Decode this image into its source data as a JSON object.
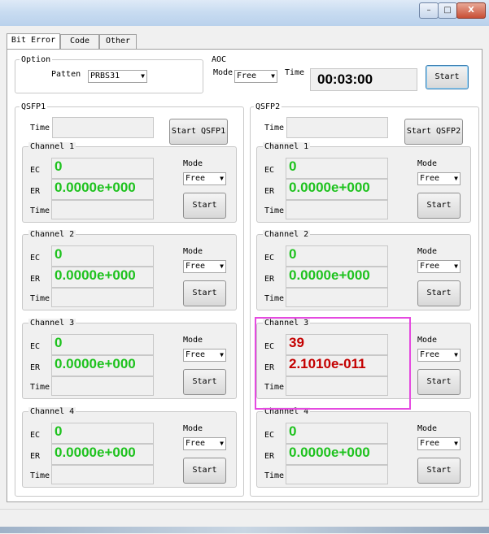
{
  "window": {
    "minimize_label": "–",
    "maximize_label": "□",
    "close_label": "X"
  },
  "tabs": [
    {
      "label": "Bit Error"
    },
    {
      "label": "Code"
    },
    {
      "label": "Other"
    }
  ],
  "option": {
    "group_label": "Option",
    "pattern_label": "Patten",
    "pattern_value": "PRBS31"
  },
  "aoc": {
    "group_label": "AOC",
    "mode_label": "Mode",
    "mode_value": "Free",
    "time_label": "Time",
    "timer": "00:03:00",
    "start_label": "Start"
  },
  "qsfp1": {
    "group_label": "QSFP1",
    "time_label": "Time",
    "start_label": "Start QSFP1",
    "channels": [
      {
        "label": "Channel 1",
        "ec": "0",
        "er": "0.0000e+000",
        "mode_label": "Mode",
        "mode": "Free",
        "start_label": "Start",
        "ec_label": "EC",
        "er_label": "ER",
        "time_label": "Time"
      },
      {
        "label": "Channel 2",
        "ec": "0",
        "er": "0.0000e+000",
        "mode_label": "Mode",
        "mode": "Free",
        "start_label": "Start",
        "ec_label": "EC",
        "er_label": "ER",
        "time_label": "Time"
      },
      {
        "label": "Channel 3",
        "ec": "0",
        "er": "0.0000e+000",
        "mode_label": "Mode",
        "mode": "Free",
        "start_label": "Start",
        "ec_label": "EC",
        "er_label": "ER",
        "time_label": "Time"
      },
      {
        "label": "Channel 4",
        "ec": "0",
        "er": "0.0000e+000",
        "mode_label": "Mode",
        "mode": "Free",
        "start_label": "Start",
        "ec_label": "EC",
        "er_label": "ER",
        "time_label": "Time"
      }
    ]
  },
  "qsfp2": {
    "group_label": "QSFP2",
    "time_label": "Time",
    "start_label": "Start QSFP2",
    "channels": [
      {
        "label": "Channel 1",
        "ec": "0",
        "er": "0.0000e+000",
        "mode_label": "Mode",
        "mode": "Free",
        "start_label": "Start",
        "ec_label": "EC",
        "er_label": "ER",
        "time_label": "Time"
      },
      {
        "label": "Channel 2",
        "ec": "0",
        "er": "0.0000e+000",
        "mode_label": "Mode",
        "mode": "Free",
        "start_label": "Start",
        "ec_label": "EC",
        "er_label": "ER",
        "time_label": "Time"
      },
      {
        "label": "Channel 3",
        "ec": "39",
        "er": "2.1010e-011",
        "mode_label": "Mode",
        "mode": "Free",
        "start_label": "Start",
        "ec_label": "EC",
        "er_label": "ER",
        "time_label": "Time",
        "highlighted": true
      },
      {
        "label": "Channel 4",
        "ec": "0",
        "er": "0.0000e+000",
        "mode_label": "Mode",
        "mode": "Free",
        "start_label": "Start",
        "ec_label": "EC",
        "er_label": "ER",
        "time_label": "Time"
      }
    ]
  },
  "colors": {
    "ok_value": "#1ec21e",
    "error_value": "#c40000",
    "highlight_box": "#e54ae0"
  }
}
